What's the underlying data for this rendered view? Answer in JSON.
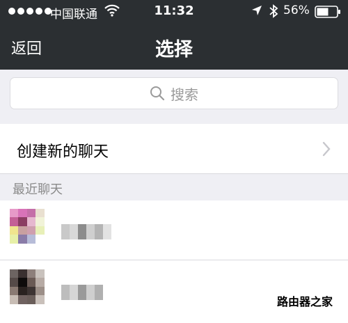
{
  "status_bar": {
    "carrier": "中国联通",
    "time": "11:32",
    "battery": "56%",
    "signal_dots": 5,
    "icons": [
      "signal-dots-icon",
      "wifi-icon",
      "location-arrow-icon",
      "bluetooth-icon",
      "battery-icon"
    ]
  },
  "nav": {
    "back_label": "返回",
    "title": "选择"
  },
  "search": {
    "placeholder": "搜索",
    "icon": "search-icon"
  },
  "new_chat": {
    "label": "创建新的聊天",
    "icon": "chevron-right-icon"
  },
  "recent": {
    "header": "最近聊天",
    "contacts": [
      {
        "avatar_colors": [
          "#e79ac8",
          "#d873b8",
          "#c46fa8",
          "#e9e0d0",
          "#ffffff",
          "#c45f96",
          "#8b3d62",
          "#e6b8cf",
          "#f1f3d8",
          "#ffffff",
          "#f0e58e",
          "#c8a0a0",
          "#cf9fae",
          "#e8f0b8",
          "#ffffff",
          "#e7f0a8",
          "#8a7ca8",
          "#b7bcd8",
          "#ffffff",
          "#ffffff",
          "#ffffff",
          "#ffffff",
          "#ffffff",
          "#ffffff",
          "#ffffff"
        ],
        "name_blur_colors": [
          "#c9c9c9",
          "#d8d8d8",
          "#8c8c8c",
          "#cfcfcf",
          "#b4b4b4",
          "#e2e2e2"
        ]
      },
      {
        "avatar_colors": [
          "#6d6462",
          "#3a3030",
          "#8d7f7b",
          "#c9c2bd",
          "#ffffff",
          "#554a48",
          "#0e0b0b",
          "#6a5a55",
          "#b7aba5",
          "#ffffff",
          "#8a7a73",
          "#2a2220",
          "#3c3332",
          "#9c8f88",
          "#ffffff",
          "#c8bdb5",
          "#706260",
          "#6a5e5a",
          "#c9c0ba",
          "#ffffff",
          "#ffffff",
          "#ffffff",
          "#ffffff",
          "#ffffff",
          "#ffffff"
        ],
        "name_blur_colors": [
          "#bdbdbd",
          "#d6d6d6",
          "#9a9a9a",
          "#cfcfcf",
          "#b0b0b0"
        ]
      }
    ]
  },
  "watermark": "路由器之家",
  "colors": {
    "nav_bg": "#2b2f32",
    "page_bg": "#efeff4",
    "placeholder": "#9a9a9a",
    "section_text": "#8a8a8a"
  }
}
